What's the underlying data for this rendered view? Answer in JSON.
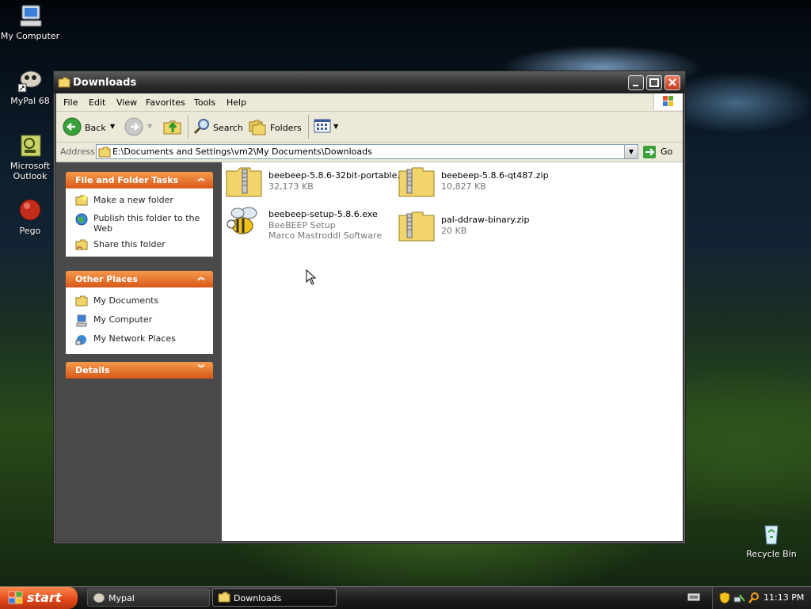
{
  "desktop": {
    "icons": [
      {
        "label": "My Computer"
      },
      {
        "label": "MyPal 68"
      },
      {
        "label": "Microsoft Outlook"
      },
      {
        "label": "Pego"
      },
      {
        "label": "Recycle Bin"
      }
    ]
  },
  "window": {
    "title": "Downloads",
    "menu": [
      "File",
      "Edit",
      "View",
      "Favorites",
      "Tools",
      "Help"
    ],
    "toolbar": {
      "back": "Back",
      "search": "Search",
      "folders": "Folders"
    },
    "address": {
      "label": "Address",
      "value": "E:\\Documents and Settings\\vm2\\My Documents\\Downloads",
      "go": "Go"
    },
    "panels": {
      "file_tasks": {
        "title": "File and Folder Tasks",
        "items": [
          "Make a new folder",
          "Publish this folder to the Web",
          "Share this folder"
        ]
      },
      "other_places": {
        "title": "Other Places",
        "items": [
          "My Documents",
          "My Computer",
          "My Network Places"
        ]
      },
      "details": {
        "title": "Details"
      }
    },
    "files": [
      {
        "name": "beebeep-5.8.6-32bit-portable...",
        "info": "32,173 KB"
      },
      {
        "name": "beebeep-5.8.6-qt487.zip",
        "info": "10,827 KB"
      },
      {
        "name": "beebeep-setup-5.8.6.exe",
        "info": "BeeBEEP Setup",
        "info2": "Marco Mastroddi Software"
      },
      {
        "name": "pal-ddraw-binary.zip",
        "info": "20 KB"
      }
    ]
  },
  "taskbar": {
    "start": "start",
    "buttons": [
      "Mypal",
      "Downloads"
    ],
    "clock": "11:13 PM"
  },
  "colors": {
    "panel_header": "#e06a2a",
    "desktop_bg": "#0d1d2c",
    "window_frame": "#3c3c3c"
  }
}
